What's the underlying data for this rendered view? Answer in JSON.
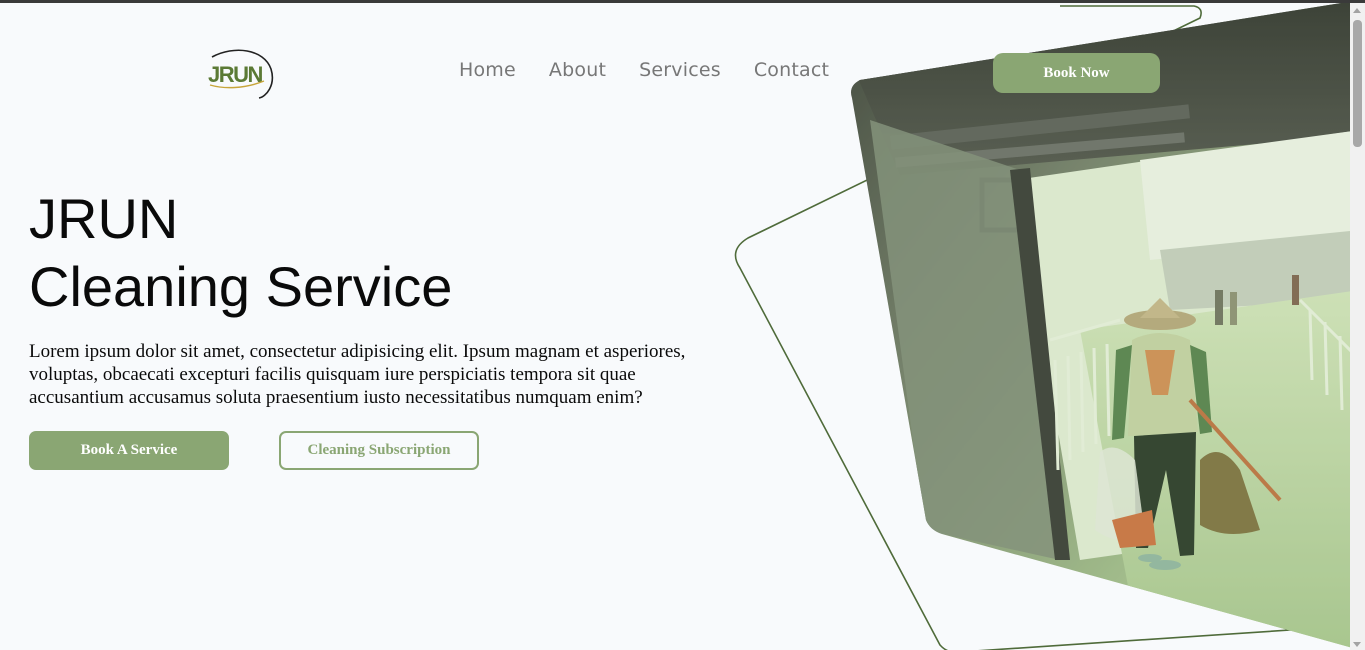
{
  "logo": {
    "text": "JRUN"
  },
  "nav": {
    "items": [
      "Home",
      "About",
      "Services",
      "Contact"
    ]
  },
  "header": {
    "book_now_label": "Book Now"
  },
  "hero": {
    "title_line1": "JRUN",
    "title_line2": "Cleaning Service",
    "description": "Lorem ipsum dolor sit amet, consectetur adipisicing elit. Ipsum magnam et asperiores, voluptas, obcaecati excepturi facilis quisquam iure perspiciatis tempora sit quae accusantium accusamus soluta praesentium iusto necessitatibus numquam enim?",
    "primary_button": "Book A Service",
    "secondary_button": "Cleaning Subscription"
  },
  "theme": {
    "accent": "#8aa673",
    "outline": "#4f6b3a",
    "text": "#0a0a0a",
    "nav_text": "#777777",
    "background": "#f8fafc"
  },
  "icons": {
    "hero_image": "street-cleaner-photo",
    "logo_mark": "jrun-logo-icon"
  }
}
